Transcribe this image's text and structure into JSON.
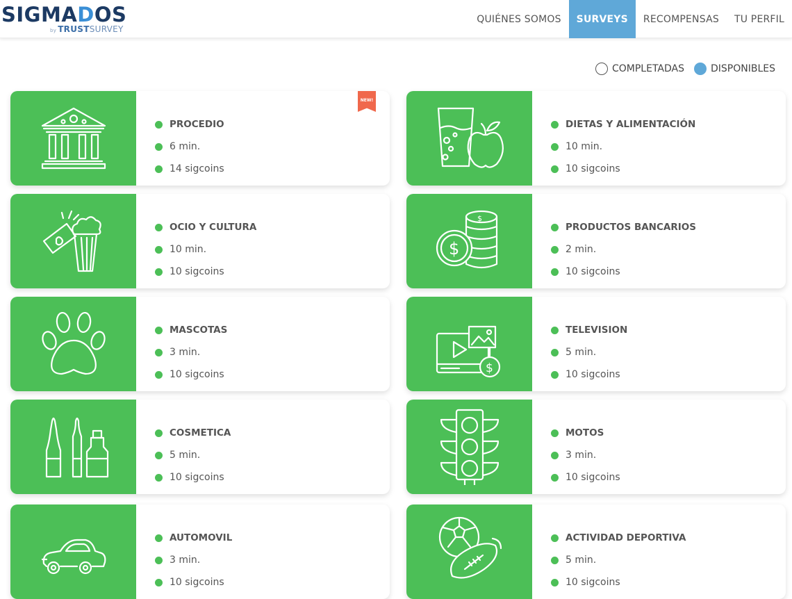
{
  "header": {
    "logo": {
      "text_a": "SIGMA",
      "text_o": "D",
      "text_b": "OS",
      "by": "by",
      "sub_a": "TRUST",
      "sub_b": "SURVEY"
    },
    "nav": [
      {
        "label": "QUIÉNES SOMOS",
        "active": false
      },
      {
        "label": "SURVEYS",
        "active": true
      },
      {
        "label": "RECOMPENSAS",
        "active": false
      },
      {
        "label": "TU PERFIL",
        "active": false
      }
    ]
  },
  "filter": {
    "completadas": {
      "label": "COMPLETADAS",
      "checked": false
    },
    "disponibles": {
      "label": "DISPONIBLES",
      "checked": true
    }
  },
  "colors": {
    "accent": "#4cbf57",
    "nav_active": "#5fa8d8",
    "badge": "#f0684c"
  },
  "surveys": [
    {
      "title": "PROCEDIO",
      "duration": "6 min.",
      "reward": "14 sigcoins",
      "icon": "bank-icon",
      "badge": "NEW!"
    },
    {
      "title": "DIETAS Y ALIMENTACIÓN",
      "duration": "10 min.",
      "reward": "10 sigcoins",
      "icon": "apple-drink-icon"
    },
    {
      "title": "OCIO Y CULTURA",
      "duration": "10 min.",
      "reward": "10 sigcoins",
      "icon": "popcorn-icon"
    },
    {
      "title": "PRODUCTOS BANCARIOS",
      "duration": "2 min.",
      "reward": "10 sigcoins",
      "icon": "coins-icon"
    },
    {
      "title": "MASCOTAS",
      "duration": "3 min.",
      "reward": "10 sigcoins",
      "icon": "paw-icon"
    },
    {
      "title": "TELEVISION",
      "duration": "5 min.",
      "reward": "10 sigcoins",
      "icon": "video-money-icon"
    },
    {
      "title": "COSMETICA",
      "duration": "5 min.",
      "reward": "10 sigcoins",
      "icon": "cosmetic-bottles-icon"
    },
    {
      "title": "MOTOS",
      "duration": "3 min.",
      "reward": "10 sigcoins",
      "icon": "traffic-light-icon"
    },
    {
      "title": "AUTOMOVIL",
      "duration": "3 min.",
      "reward": "10 sigcoins",
      "icon": "car-icon"
    },
    {
      "title": "ACTIVIDAD DEPORTIVA",
      "duration": "5 min.",
      "reward": "10 sigcoins",
      "icon": "sports-balls-icon"
    }
  ]
}
